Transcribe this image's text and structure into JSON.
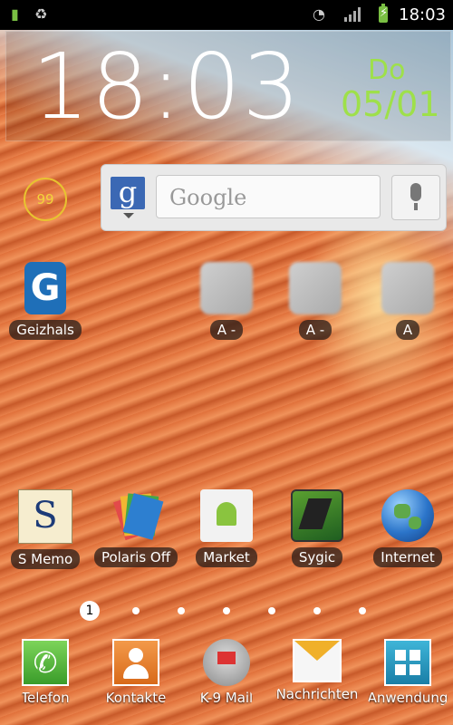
{
  "status_bar": {
    "time": "18:03",
    "icons": [
      "battery-status-icon",
      "recycle-icon",
      "wifi-icon",
      "signal-icon",
      "battery-charging-icon"
    ]
  },
  "clock_widget": {
    "time": "18:03",
    "day": "Do",
    "date": "05/01"
  },
  "notification_badge": {
    "count": "99"
  },
  "search_widget": {
    "placeholder": "Google",
    "logo": "g"
  },
  "home_apps_row1": [
    {
      "label": "Geizhals",
      "icon": "geizhals-icon"
    },
    {
      "label": "A -",
      "icon": "contact-a-icon"
    },
    {
      "label": "A -",
      "icon": "contact-a-icon"
    },
    {
      "label": "A",
      "icon": "contact-a-icon"
    }
  ],
  "home_apps_row2": [
    {
      "label": "S Memo",
      "icon": "s-memo-icon"
    },
    {
      "label": "Polaris Off",
      "icon": "polaris-office-icon"
    },
    {
      "label": "Market",
      "icon": "market-icon"
    },
    {
      "label": "Sygic",
      "icon": "sygic-icon"
    },
    {
      "label": "Internet",
      "icon": "internet-globe-icon"
    }
  ],
  "page_indicator": {
    "current": "1",
    "total": 7
  },
  "dock": [
    {
      "label": "Telefon",
      "icon": "phone-icon"
    },
    {
      "label": "Kontakte",
      "icon": "contacts-icon"
    },
    {
      "label": "K-9 Mail",
      "icon": "k9-mail-icon"
    },
    {
      "label": "Nachrichten",
      "icon": "messages-icon"
    },
    {
      "label": "Anwendung",
      "icon": "apps-grid-icon"
    }
  ]
}
